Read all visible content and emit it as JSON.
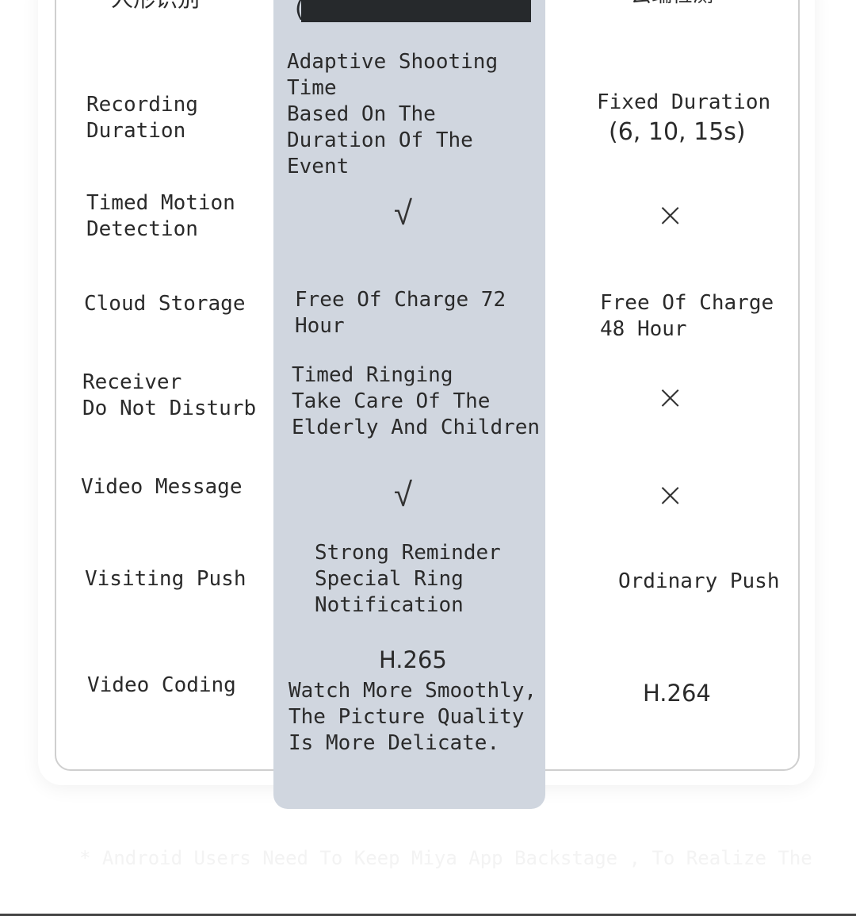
{
  "header": {
    "left": "人形识别",
    "right": "云端检测"
  },
  "rows": [
    {
      "feature": "Recording\nDuration",
      "ours": "Adaptive Shooting\nTime\nBased On The\nDuration Of The\nEvent",
      "other": "Fixed Duration",
      "other2": "(6, 10, 15s)"
    },
    {
      "feature": "Timed Motion\nDetection",
      "ours_icon": "check-icon",
      "other_icon": "cross-icon"
    },
    {
      "feature": "Cloud Storage",
      "ours": "Free Of Charge 72\nHour",
      "other": "Free Of Charge\n48 Hour"
    },
    {
      "feature": "Receiver\nDo Not Disturb",
      "ours": "Timed Ringing\nTake Care Of The\nElderly And Children",
      "other_icon": "cross-icon"
    },
    {
      "feature": "Video Message",
      "ours_icon": "check-icon",
      "other_icon": "cross-icon"
    },
    {
      "feature": "Visiting Push",
      "ours": "Strong Reminder\nSpecial Ring\nNotification",
      "other": "Ordinary Push"
    },
    {
      "feature": "Video Coding",
      "ours_title": "H.265",
      "ours": "Watch More Smoothly,\nThe Picture Quality\nIs More Delicate.",
      "other": "H.264"
    }
  ],
  "symbols": {
    "check": "√",
    "cross": "×"
  },
  "colors": {
    "highlight": "#d0d6df",
    "bar": "#26292c"
  },
  "footnote": "* Android Users Need To Keep Miya App Backstage , To Realize The"
}
